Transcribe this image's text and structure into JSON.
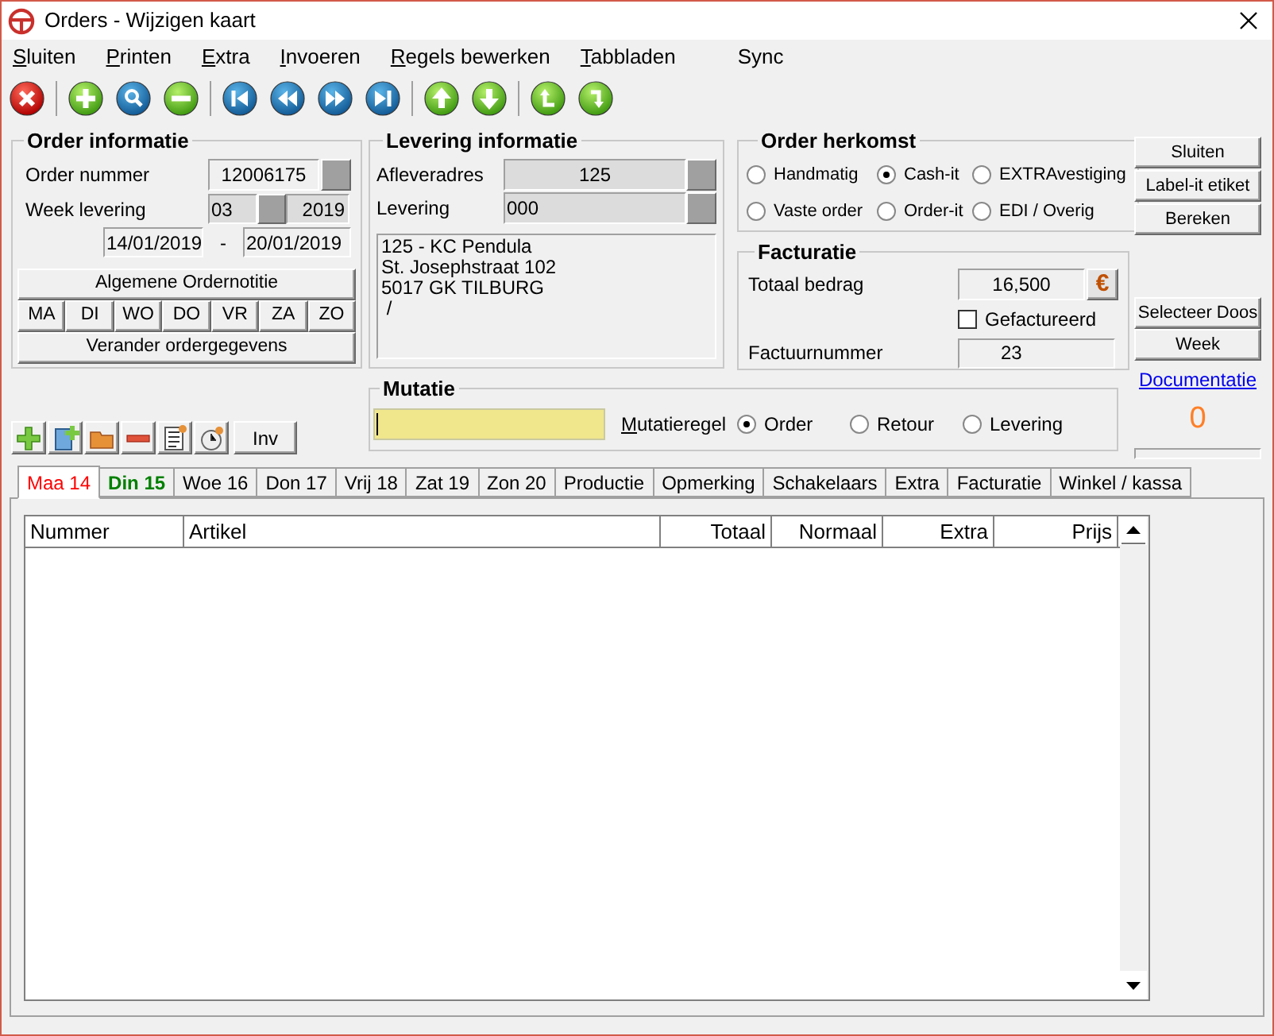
{
  "window": {
    "title": "Orders - Wijzigen kaart"
  },
  "menu": [
    {
      "mnemonic": "S",
      "rest": "luiten"
    },
    {
      "mnemonic": "P",
      "rest": "rinten"
    },
    {
      "mnemonic": "E",
      "rest": "xtra"
    },
    {
      "mnemonic": "I",
      "rest": "nvoeren"
    },
    {
      "mnemonic": "R",
      "rest": "egels bewerken"
    },
    {
      "mnemonic": "T",
      "rest": "abbladen"
    },
    {
      "rest": "Sync"
    }
  ],
  "order_info": {
    "title": "Order informatie",
    "order_label": "Order nummer",
    "order_value": "12006175",
    "week_label": "Week levering",
    "week_value": "03",
    "year_value": "2019",
    "date_from": "14/01/2019",
    "date_separator": "-",
    "date_to": "20/01/2019",
    "note_button": "Algemene Ordernotitie",
    "days": [
      "MA",
      "DI",
      "WO",
      "DO",
      "VR",
      "ZA",
      "ZO"
    ],
    "change_button": "Verander ordergegevens"
  },
  "levering_info": {
    "title": "Levering informatie",
    "address_label": "Afleveradres",
    "address_value": "125",
    "delivery_label": "Levering",
    "delivery_value": "000",
    "address_lines": [
      "125 - KC Pendula",
      "St. Josephstraat 102",
      "5017 GK TILBURG",
      " /"
    ]
  },
  "order_herkomst": {
    "title": "Order herkomst",
    "options": [
      {
        "label": "Handmatig",
        "selected": false
      },
      {
        "label": "Cash-it",
        "selected": true
      },
      {
        "label": "EXTRAvestiging",
        "selected": false
      },
      {
        "label": "Vaste order",
        "selected": false
      },
      {
        "label": "Order-it",
        "selected": false
      },
      {
        "label": "EDI / Overig",
        "selected": false
      }
    ]
  },
  "facturatie": {
    "title": "Facturatie",
    "total_label": "Totaal bedrag",
    "total_value": "16,500",
    "currency_button": "€",
    "invoiced": {
      "label": "Gefactureerd",
      "checked": false
    },
    "invoice_label": "Factuurnummer",
    "invoice_value": "23"
  },
  "side_buttons": [
    "Sluiten",
    "Label-it etiket",
    "Bereken"
  ],
  "side_buttons_2": [
    "Selecteer Doos",
    "Week"
  ],
  "documentation_link": "Documentatie",
  "counter": "0",
  "progress": {
    "level": 0
  },
  "mutatie": {
    "title": "Mutatie",
    "label_mnemonic": "M",
    "label_rest": "utatieregel",
    "options": [
      {
        "label": "Order",
        "selected": true
      },
      {
        "label": "Retour",
        "selected": false
      },
      {
        "label": "Levering",
        "selected": false
      }
    ]
  },
  "inv_button": "Inv",
  "tabs": [
    {
      "label": "Maa 14",
      "selected": true,
      "color": "#ff0000",
      "bold": false
    },
    {
      "label": "Din 15",
      "selected": false,
      "color": "#008000",
      "bold": true
    },
    {
      "label": "Woe 16",
      "selected": false,
      "color": "#000000",
      "bold": false
    },
    {
      "label": "Don 17",
      "selected": false,
      "color": "#000000",
      "bold": false
    },
    {
      "label": "Vrij 18",
      "selected": false,
      "color": "#000000",
      "bold": false
    },
    {
      "label": "Zat 19",
      "selected": false,
      "color": "#000000",
      "bold": false
    },
    {
      "label": "Zon 20",
      "selected": false,
      "color": "#000000",
      "bold": false
    },
    {
      "label": "Productie",
      "selected": false,
      "color": "#000000",
      "bold": false
    },
    {
      "label": "Opmerking",
      "selected": false,
      "color": "#000000",
      "bold": false
    },
    {
      "label": "Schakelaars",
      "selected": false,
      "color": "#000000",
      "bold": false
    },
    {
      "label": "Extra",
      "selected": false,
      "color": "#000000",
      "bold": false
    },
    {
      "label": "Facturatie",
      "selected": false,
      "color": "#000000",
      "bold": false
    },
    {
      "label": "Winkel / kassa",
      "selected": false,
      "color": "#000000",
      "bold": false
    }
  ],
  "table": {
    "columns": [
      {
        "label": "Nummer"
      },
      {
        "label": "Artikel"
      },
      {
        "label": "Totaal"
      },
      {
        "label": "Normaal"
      },
      {
        "label": "Extra"
      },
      {
        "label": "Prijs"
      }
    ]
  }
}
